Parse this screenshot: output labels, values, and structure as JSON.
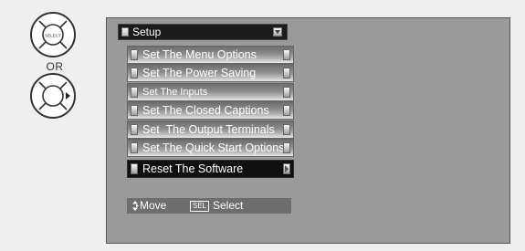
{
  "remote": {
    "select_button_label": "SELECT",
    "or_label": "OR",
    "icons": [
      "select-button-icon",
      "right-arrow-button-icon"
    ]
  },
  "menu": {
    "title": "Setup",
    "items": [
      {
        "label": "Set The Menu Options"
      },
      {
        "label": "Set The Power Saving"
      },
      {
        "label": "Set The Inputs"
      },
      {
        "label": "Set The Closed Captions"
      },
      {
        "label": "Set  The Output Terminals"
      },
      {
        "label": "Set The Quick Start Options"
      },
      {
        "label": "Reset The Software",
        "selected": true
      }
    ]
  },
  "help": {
    "move_label": "Move",
    "sel_key": "SEL",
    "select_label": "Select"
  },
  "colors": {
    "screen_bg": "#9a9a9a",
    "title_bg": "#1b1b1b",
    "selected_bg": "#101010",
    "help_bg": "#6e6e6e"
  }
}
